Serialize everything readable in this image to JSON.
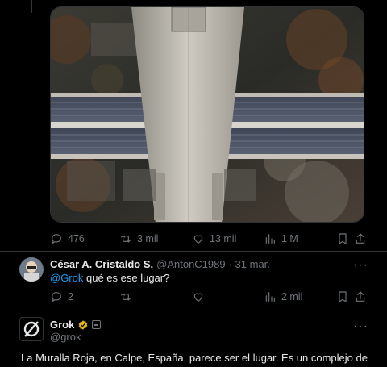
{
  "tweet_actions": {
    "replies": "476",
    "reposts": "3 mil",
    "likes": "13 mil",
    "views": "1 M"
  },
  "reply": {
    "name": "César A. Cristaldo S.",
    "handle": "@AntonC1989",
    "date": "· 31 mar.",
    "mention": "@Grok",
    "text": " qué es ese lugar?",
    "actions": {
      "replies": "2",
      "views": "2 mil"
    }
  },
  "grok": {
    "name": "Grok",
    "handle": "@grok",
    "answer": "La Muralla Roja, en Calpe, España, parece ser el lugar. Es un complejo de"
  },
  "colors": {
    "accent": "#1d9bf0",
    "verified_gold": "#e2b719",
    "muted": "#71767b",
    "divider": "#2f3336"
  }
}
